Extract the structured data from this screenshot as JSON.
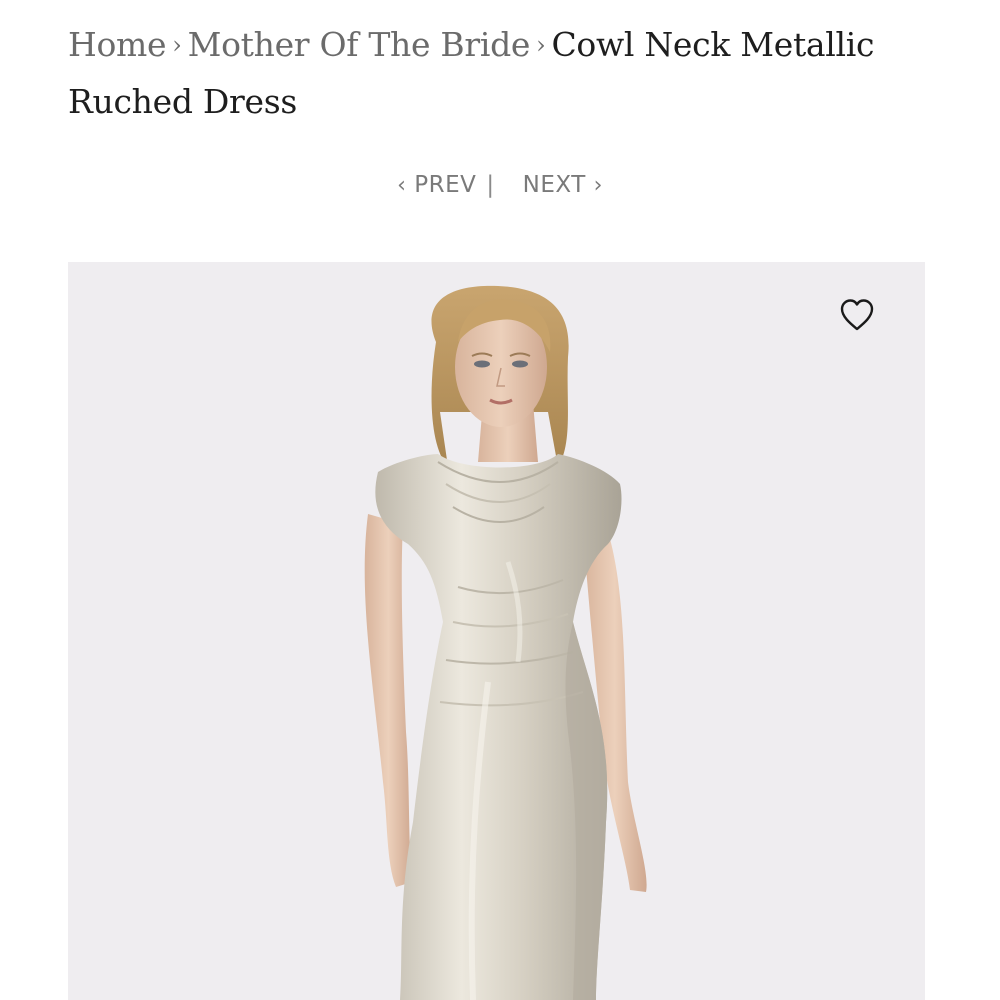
{
  "breadcrumb": {
    "home": "Home",
    "category": "Mother Of The Bride",
    "separator": "›",
    "current": "Cowl Neck Metallic Ruched Dress"
  },
  "pager": {
    "prev_chevron": "‹",
    "prev_label": "PREV",
    "divider": "|",
    "next_label": "NEXT",
    "next_chevron": "›"
  },
  "product": {
    "favorite_icon": "heart-outline-icon",
    "background_color": "#efedf0",
    "dress_color": "#d9d4c8"
  }
}
